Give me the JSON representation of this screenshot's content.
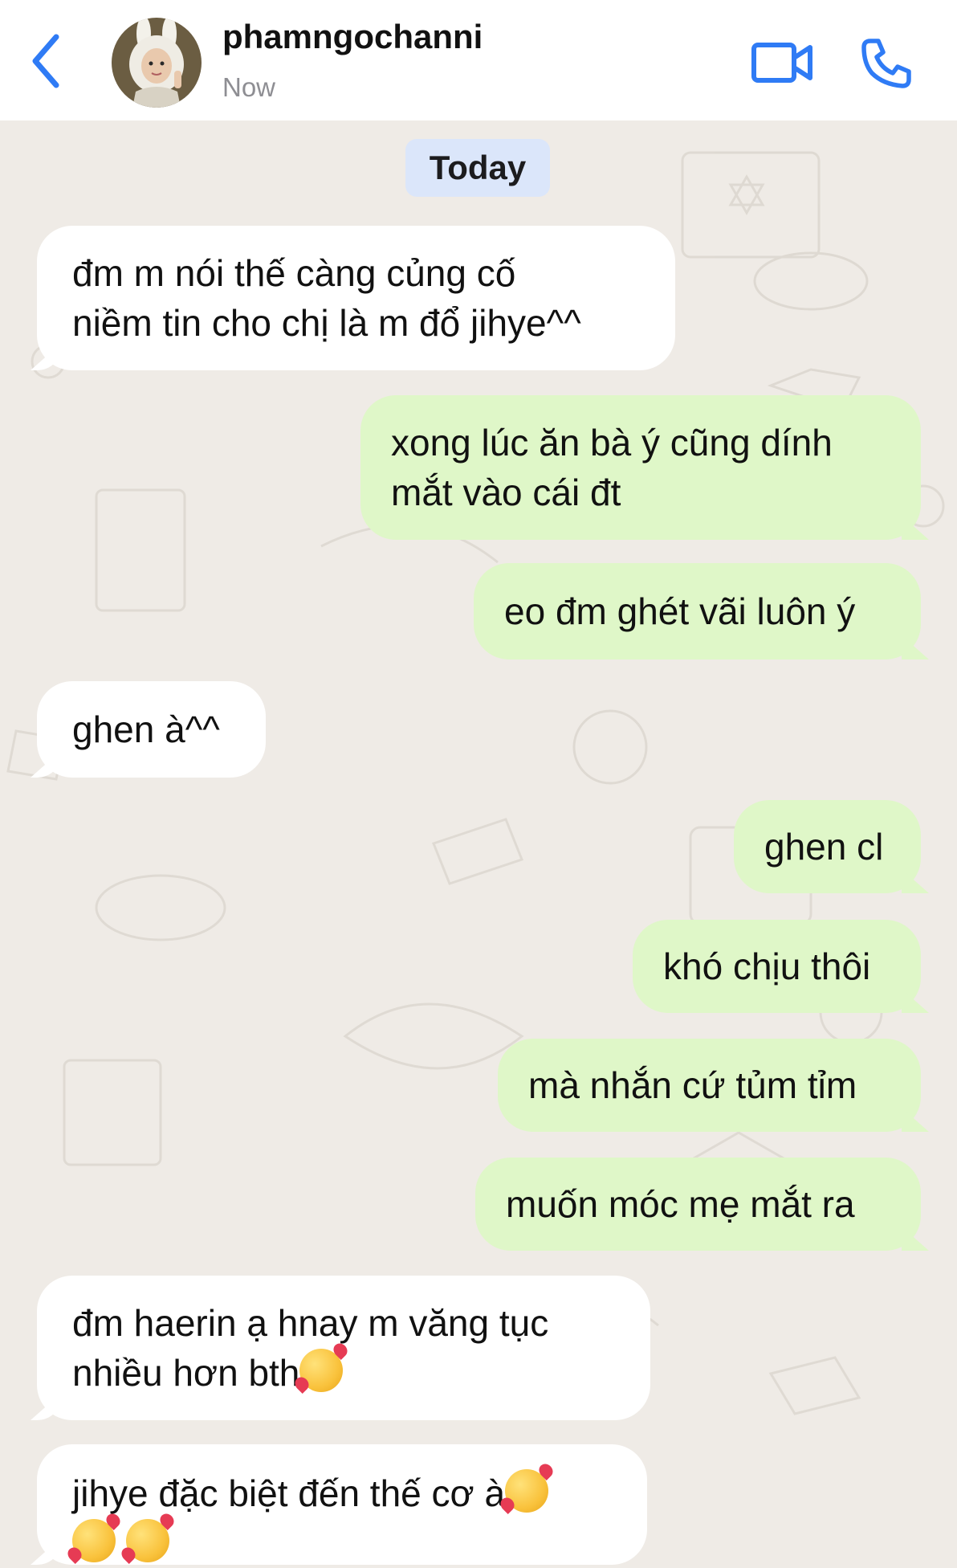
{
  "header": {
    "contact_name": "phamngochanni",
    "status": "Now",
    "back_icon": "chevron-left-icon",
    "video_icon": "video-camera-icon",
    "phone_icon": "phone-icon",
    "accent_color": "#2f7bf5"
  },
  "chat": {
    "date_label": "Today",
    "incoming_color": "#ffffff",
    "outgoing_color": "#dff7c8",
    "messages": [
      {
        "direction": "in",
        "text": "đm m nói thế càng củng cố\nniềm tin cho chị là m đổ jihye^^"
      },
      {
        "direction": "out",
        "text": "xong lúc ăn bà ý cũng dính\nmắt vào cái đt"
      },
      {
        "direction": "out",
        "text": "eo đm ghét vãi luôn ý"
      },
      {
        "direction": "in",
        "text": "ghen à^^"
      },
      {
        "direction": "out",
        "text": "ghen cl"
      },
      {
        "direction": "out",
        "text": "khó chịu thôi"
      },
      {
        "direction": "out",
        "text": "mà nhắn cứ tủm tỉm"
      },
      {
        "direction": "out",
        "text": "muốn móc mẹ mắt ra"
      },
      {
        "direction": "in",
        "text": "đm haerin ạ hnay m văng tục\nnhiều hơn bth",
        "emoji": "smiling-face-with-hearts"
      },
      {
        "direction": "in",
        "text": "jihye đặc biệt đến thế cơ à",
        "emoji": "smiling-face-with-hearts"
      }
    ]
  }
}
